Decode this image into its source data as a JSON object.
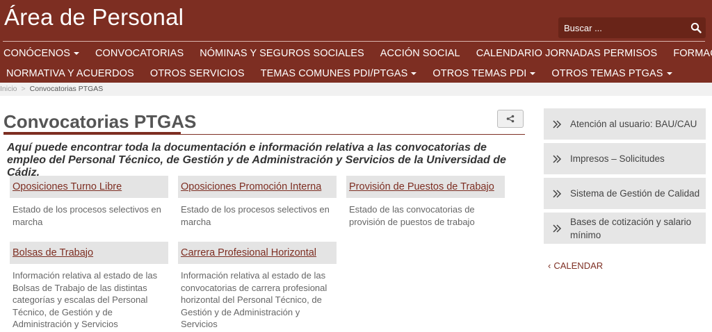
{
  "header": {
    "site_title": "Área de Personal",
    "search_placeholder": "Buscar ..."
  },
  "nav": {
    "row1": [
      {
        "label": "CONÓCENOS",
        "dropdown": true
      },
      {
        "label": "CONVOCATORIAS",
        "dropdown": false
      },
      {
        "label": "NÓMINAS Y SEGUROS SOCIALES",
        "dropdown": false
      },
      {
        "label": "ACCIÓN SOCIAL",
        "dropdown": false
      },
      {
        "label": "CALENDARIO JORNADAS PERMISOS",
        "dropdown": false
      },
      {
        "label": "FORMACIÓN",
        "dropdown": false
      }
    ],
    "row2": [
      {
        "label": "NORMATIVA Y ACUERDOS",
        "dropdown": false
      },
      {
        "label": "OTROS SERVICIOS",
        "dropdown": false
      },
      {
        "label": "TEMAS COMUNES PDI/PTGAS",
        "dropdown": true
      },
      {
        "label": "OTROS TEMAS PDI",
        "dropdown": true
      },
      {
        "label": "OTROS TEMAS PTGAS",
        "dropdown": true
      }
    ]
  },
  "breadcrumb": {
    "home": "Inicio",
    "separator": ">",
    "current": "Convocatorias PTGAS"
  },
  "main": {
    "title": "Convocatorias PTGAS",
    "intro": "Aquí puede encontrar toda la documentación e información relativa a las convocatorias de empleo del Personal Técnico, de Gestión y de Administración y Servicios de la Universidad de Cádiz.",
    "cards": [
      {
        "title": "Oposiciones Turno Libre",
        "desc": "Estado de los procesos selectivos en marcha"
      },
      {
        "title": "Oposiciones Promoción Interna",
        "desc": "Estado de los procesos selectivos en marcha"
      },
      {
        "title": "Provisión de Puestos de Trabajo",
        "desc": "Estado de las convocatorias de provisión de puestos de trabajo"
      },
      {
        "title": "Bolsas de Trabajo",
        "desc": "Información relativa al estado de las Bolsas de Trabajo de las distintas categorías y escalas del Personal Técnico, de Gestión y de Administración y Servicios"
      },
      {
        "title": "Carrera Profesional Horizontal",
        "desc": "Información relativa al estado de las convocatorias de carrera profesional horizontal del  Personal Técnico, de Gestión y de Administración y Servicios"
      }
    ]
  },
  "sidebar": {
    "items": [
      {
        "label": "Atención al usuario: BAU/CAU"
      },
      {
        "label": "Impresos – Solicitudes"
      },
      {
        "label": "Sistema de Gestión de Calidad"
      },
      {
        "label": "Bases de cotización y salario mínimo"
      }
    ],
    "calendar_label": "CALENDAR",
    "calendar_prefix": "‹"
  },
  "colors": {
    "brand": "#7d2e22",
    "search_bg": "#692418",
    "card_bg": "#e4e4e4",
    "sidebar_bg": "#e6e6e6"
  }
}
